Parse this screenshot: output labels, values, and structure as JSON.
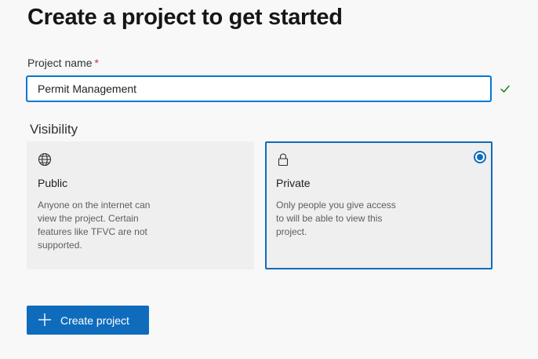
{
  "page": {
    "title": "Create a project to get started"
  },
  "project_name": {
    "label": "Project name",
    "required_marker": "*",
    "value": "Permit Management",
    "valid_icon": "checkmark-icon"
  },
  "visibility": {
    "label": "Visibility",
    "selected": "Private",
    "options": [
      {
        "icon": "globe-icon",
        "title": "Public",
        "description": "Anyone on the internet can view the project. Certain features like TFVC are not supported."
      },
      {
        "icon": "lock-icon",
        "title": "Private",
        "description": "Only people you give access to will be able to view this project."
      }
    ]
  },
  "actions": {
    "create_label": "Create project",
    "create_icon": "plus-icon"
  },
  "colors": {
    "accent": "#0f6cbd",
    "valid": "#107c10",
    "required": "#c4314b"
  }
}
